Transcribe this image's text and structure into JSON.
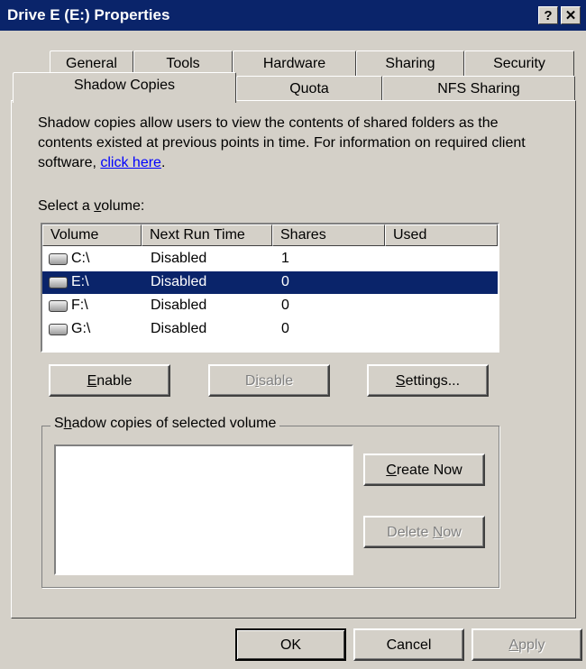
{
  "window": {
    "title": "Drive E (E:) Properties",
    "help_button": "?",
    "close_button": "✕"
  },
  "tabs_row1": [
    "General",
    "Tools",
    "Hardware",
    "Sharing",
    "Security"
  ],
  "tabs_row2": [
    "Shadow Copies",
    "Quota",
    "NFS Sharing"
  ],
  "active_tab": "Shadow Copies",
  "description": {
    "text": "Shadow copies allow users to view the contents of shared folders as the contents existed at previous points in time. For information on required client software, ",
    "link": "click here",
    "suffix": "."
  },
  "volume_section": {
    "label_pre": "Select a ",
    "label_key": "v",
    "label_post": "olume:",
    "columns": [
      "Volume",
      "Next Run Time",
      "Shares",
      "Used"
    ],
    "rows": [
      {
        "volume": "C:\\",
        "next_run": "Disabled",
        "shares": "1",
        "used": "",
        "selected": false
      },
      {
        "volume": "E:\\",
        "next_run": "Disabled",
        "shares": "0",
        "used": "",
        "selected": true
      },
      {
        "volume": "F:\\",
        "next_run": "Disabled",
        "shares": "0",
        "used": "",
        "selected": false
      },
      {
        "volume": "G:\\",
        "next_run": "Disabled",
        "shares": "0",
        "used": "",
        "selected": false
      }
    ]
  },
  "buttons": {
    "enable": {
      "key": "E",
      "rest": "nable"
    },
    "disable": {
      "pre": "D",
      "key": "i",
      "rest": "sable"
    },
    "settings": {
      "key": "S",
      "rest": "ettings..."
    },
    "create_now": {
      "key": "C",
      "rest": "reate Now"
    },
    "delete_now": {
      "pre": "Delete ",
      "key": "N",
      "rest": "ow"
    },
    "ok": "OK",
    "cancel": "Cancel",
    "apply": {
      "key": "A",
      "rest": "pply"
    }
  },
  "shadow_group": {
    "label_pre": "S",
    "label_key": "h",
    "label_post": "adow copies of selected volume"
  },
  "colors": {
    "titlebar": "#0a246a",
    "selection": "#0a246a",
    "face": "#d4d0c8",
    "link": "#0000ff"
  }
}
